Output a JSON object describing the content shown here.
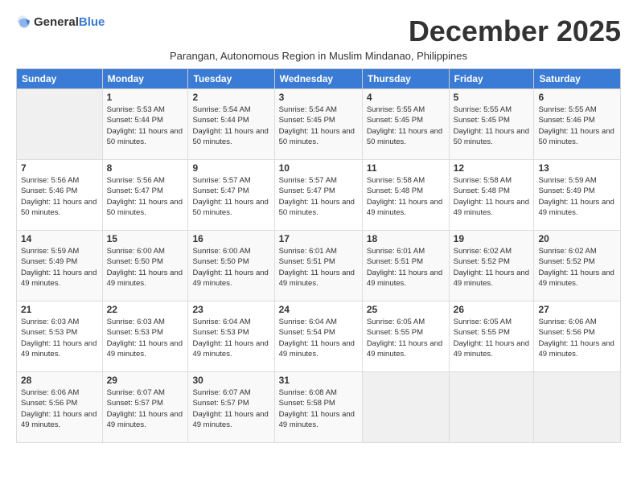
{
  "header": {
    "logo_general": "General",
    "logo_blue": "Blue",
    "month_title": "December 2025",
    "subtitle": "Parangan, Autonomous Region in Muslim Mindanao, Philippines"
  },
  "days_of_week": [
    "Sunday",
    "Monday",
    "Tuesday",
    "Wednesday",
    "Thursday",
    "Friday",
    "Saturday"
  ],
  "weeks": [
    [
      {
        "num": "",
        "empty": true
      },
      {
        "num": "1",
        "sunrise": "5:53 AM",
        "sunset": "5:44 PM",
        "daylight": "11 hours and 50 minutes."
      },
      {
        "num": "2",
        "sunrise": "5:54 AM",
        "sunset": "5:44 PM",
        "daylight": "11 hours and 50 minutes."
      },
      {
        "num": "3",
        "sunrise": "5:54 AM",
        "sunset": "5:45 PM",
        "daylight": "11 hours and 50 minutes."
      },
      {
        "num": "4",
        "sunrise": "5:55 AM",
        "sunset": "5:45 PM",
        "daylight": "11 hours and 50 minutes."
      },
      {
        "num": "5",
        "sunrise": "5:55 AM",
        "sunset": "5:45 PM",
        "daylight": "11 hours and 50 minutes."
      },
      {
        "num": "6",
        "sunrise": "5:55 AM",
        "sunset": "5:46 PM",
        "daylight": "11 hours and 50 minutes."
      }
    ],
    [
      {
        "num": "7",
        "sunrise": "5:56 AM",
        "sunset": "5:46 PM",
        "daylight": "11 hours and 50 minutes."
      },
      {
        "num": "8",
        "sunrise": "5:56 AM",
        "sunset": "5:47 PM",
        "daylight": "11 hours and 50 minutes."
      },
      {
        "num": "9",
        "sunrise": "5:57 AM",
        "sunset": "5:47 PM",
        "daylight": "11 hours and 50 minutes."
      },
      {
        "num": "10",
        "sunrise": "5:57 AM",
        "sunset": "5:47 PM",
        "daylight": "11 hours and 50 minutes."
      },
      {
        "num": "11",
        "sunrise": "5:58 AM",
        "sunset": "5:48 PM",
        "daylight": "11 hours and 49 minutes."
      },
      {
        "num": "12",
        "sunrise": "5:58 AM",
        "sunset": "5:48 PM",
        "daylight": "11 hours and 49 minutes."
      },
      {
        "num": "13",
        "sunrise": "5:59 AM",
        "sunset": "5:49 PM",
        "daylight": "11 hours and 49 minutes."
      }
    ],
    [
      {
        "num": "14",
        "sunrise": "5:59 AM",
        "sunset": "5:49 PM",
        "daylight": "11 hours and 49 minutes."
      },
      {
        "num": "15",
        "sunrise": "6:00 AM",
        "sunset": "5:50 PM",
        "daylight": "11 hours and 49 minutes."
      },
      {
        "num": "16",
        "sunrise": "6:00 AM",
        "sunset": "5:50 PM",
        "daylight": "11 hours and 49 minutes."
      },
      {
        "num": "17",
        "sunrise": "6:01 AM",
        "sunset": "5:51 PM",
        "daylight": "11 hours and 49 minutes."
      },
      {
        "num": "18",
        "sunrise": "6:01 AM",
        "sunset": "5:51 PM",
        "daylight": "11 hours and 49 minutes."
      },
      {
        "num": "19",
        "sunrise": "6:02 AM",
        "sunset": "5:52 PM",
        "daylight": "11 hours and 49 minutes."
      },
      {
        "num": "20",
        "sunrise": "6:02 AM",
        "sunset": "5:52 PM",
        "daylight": "11 hours and 49 minutes."
      }
    ],
    [
      {
        "num": "21",
        "sunrise": "6:03 AM",
        "sunset": "5:53 PM",
        "daylight": "11 hours and 49 minutes."
      },
      {
        "num": "22",
        "sunrise": "6:03 AM",
        "sunset": "5:53 PM",
        "daylight": "11 hours and 49 minutes."
      },
      {
        "num": "23",
        "sunrise": "6:04 AM",
        "sunset": "5:53 PM",
        "daylight": "11 hours and 49 minutes."
      },
      {
        "num": "24",
        "sunrise": "6:04 AM",
        "sunset": "5:54 PM",
        "daylight": "11 hours and 49 minutes."
      },
      {
        "num": "25",
        "sunrise": "6:05 AM",
        "sunset": "5:55 PM",
        "daylight": "11 hours and 49 minutes."
      },
      {
        "num": "26",
        "sunrise": "6:05 AM",
        "sunset": "5:55 PM",
        "daylight": "11 hours and 49 minutes."
      },
      {
        "num": "27",
        "sunrise": "6:06 AM",
        "sunset": "5:56 PM",
        "daylight": "11 hours and 49 minutes."
      }
    ],
    [
      {
        "num": "28",
        "sunrise": "6:06 AM",
        "sunset": "5:56 PM",
        "daylight": "11 hours and 49 minutes."
      },
      {
        "num": "29",
        "sunrise": "6:07 AM",
        "sunset": "5:57 PM",
        "daylight": "11 hours and 49 minutes."
      },
      {
        "num": "30",
        "sunrise": "6:07 AM",
        "sunset": "5:57 PM",
        "daylight": "11 hours and 49 minutes."
      },
      {
        "num": "31",
        "sunrise": "6:08 AM",
        "sunset": "5:58 PM",
        "daylight": "11 hours and 49 minutes."
      },
      {
        "num": "",
        "empty": true
      },
      {
        "num": "",
        "empty": true
      },
      {
        "num": "",
        "empty": true
      }
    ]
  ]
}
